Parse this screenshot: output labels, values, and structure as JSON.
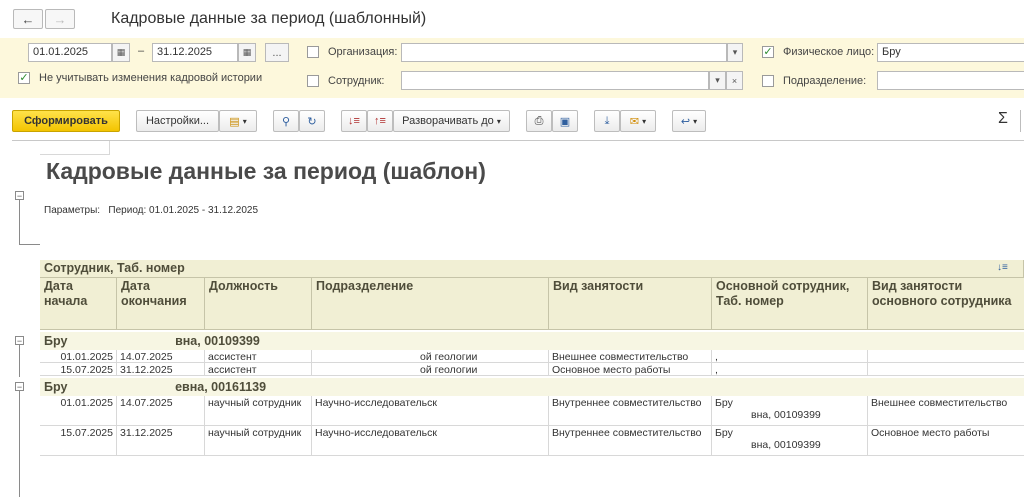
{
  "window": {
    "title": "Кадровые данные за период (шаблонный)"
  },
  "params": {
    "date_from": "01.01.2025",
    "date_sep": "–",
    "date_to": "31.12.2025",
    "period_btn": "...",
    "ignore_history_label": "Не учитывать изменения кадровой истории",
    "org_label": "Организация:",
    "org_value": "",
    "employee_label": "Сотрудник:",
    "employee_value": "",
    "person_label": "Физическое лицо:",
    "person_value": "Бру",
    "division_label": "Подразделение:",
    "division_value": ""
  },
  "toolbar": {
    "generate": "Сформировать",
    "settings": "Настройки...",
    "expand_to": "Разворачивать до",
    "sum": "Σ"
  },
  "report": {
    "title": "Кадровые данные за период (шаблон)",
    "params_line": "Параметры:   Период: 01.01.2025 - 31.12.2025",
    "group_header": "Сотрудник, Таб. номер",
    "columns": [
      "Дата начала",
      "Дата окончания",
      "Должность",
      "Подразделение",
      "Вид занятости",
      "Основной сотрудник, Таб. номер",
      "Вид занятости основного сотрудника"
    ],
    "groups": [
      {
        "name": "Бру                               вна, 00109399",
        "rows": [
          [
            "01.01.2025",
            "14.07.2025",
            "ассистент",
            "ой геологии",
            "Внешнее совместительство",
            ",",
            ""
          ],
          [
            "15.07.2025",
            "31.12.2025",
            "ассистент",
            "ой геологии",
            "Основное место работы",
            ",",
            ""
          ]
        ]
      },
      {
        "name": "Бру                               евна, 00161139",
        "rows": [
          [
            "01.01.2025",
            "14.07.2025",
            "научный сотрудник",
            "Научно-исследовательск",
            "Внутреннее совместительство",
            "Бру",
            "Внешнее совместительство"
          ],
          [
            "15.07.2025",
            "31.12.2025",
            "научный сотрудник",
            "Научно-исследовательск",
            "Внутреннее совместительство",
            "Бру",
            "Основное место работы"
          ]
        ],
        "main_emp_second_line": "вна, 00109399"
      }
    ]
  }
}
